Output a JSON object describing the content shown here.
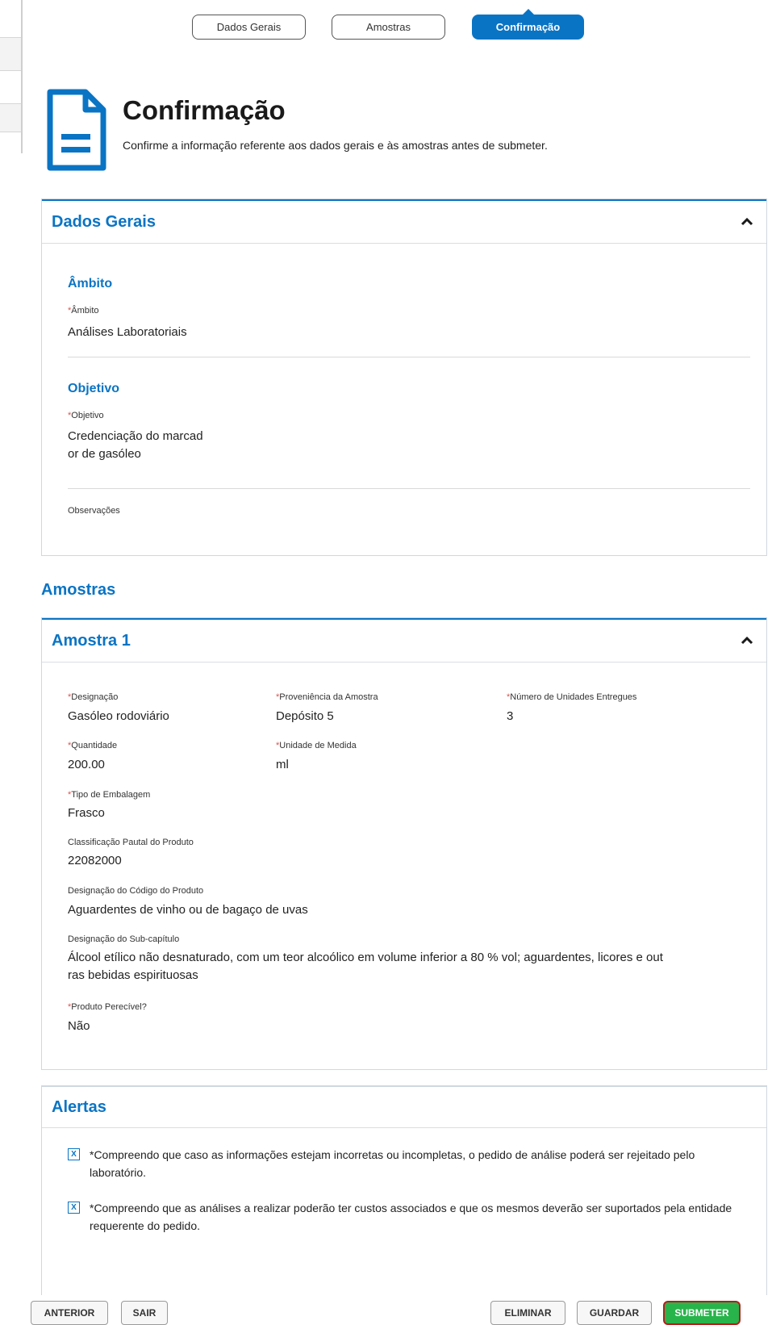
{
  "steps": [
    "Dados Gerais",
    "Amostras",
    "Confirmação"
  ],
  "header": {
    "title": "Confirmação",
    "description": "Confirme a informação referente aos dados gerais e às amostras antes de submeter."
  },
  "dados_gerais": {
    "title": "Dados Gerais",
    "ambito_section": "Âmbito",
    "ambito_label": "Âmbito",
    "ambito_value": "Análises Laboratoriais",
    "objetivo_section": "Objetivo",
    "objetivo_label": "Objetivo",
    "objetivo_value_line1": "Credenciação do marcad",
    "objetivo_value_line2": "or de gasóleo",
    "observacoes_label": "Observações"
  },
  "amostras": {
    "heading": "Amostras",
    "sample_title": "Amostra 1",
    "designacao_label": "Designação",
    "designacao_value": "Gasóleo rodoviário",
    "proveniencia_label": "Proveniência da Amostra",
    "proveniencia_value": "Depósito 5",
    "unidades_label": "Número de Unidades Entregues",
    "unidades_value": "3",
    "quantidade_label": "Quantidade",
    "quantidade_value": "200.00",
    "unidade_medida_label": "Unidade de Medida",
    "unidade_medida_value": "ml",
    "embalagem_label": "Tipo de Embalagem",
    "embalagem_value": "Frasco",
    "classificacao_label": "Classificação Pautal do Produto",
    "classificacao_value": "22082000",
    "codigo_label": "Designação do Código do Produto",
    "codigo_value": "Aguardentes de vinho ou de bagaço de uvas",
    "subcapitulo_label": "Designação do Sub-capítulo",
    "subcapitulo_value_line1": "Álcool etílico não desnaturado, com um teor alcoólico em volume inferior a 80 % vol; aguardentes, licores e out",
    "subcapitulo_value_line2": "ras bebidas espirituosas",
    "perecivel_label": "Produto Perecível?",
    "perecivel_value": "Não"
  },
  "alertas": {
    "title": "Alertas",
    "check_mark": "X",
    "items": [
      "*Compreendo que caso as informações estejam incorretas ou incompletas, o pedido de análise poderá ser rejeitado pelo laboratório.",
      "*Compreendo que as análises a realizar poderão ter custos associados e que os mesmos deverão ser suportados pela entidade requerente do pedido."
    ]
  },
  "footer": {
    "anterior": "ANTERIOR",
    "sair": "SAIR",
    "eliminar": "ELIMINAR",
    "guardar": "GUARDAR",
    "submeter": "SUBMETER"
  },
  "colors": {
    "accent": "#0a74c4",
    "required": "#d9534f",
    "submit": "#28b44b"
  }
}
